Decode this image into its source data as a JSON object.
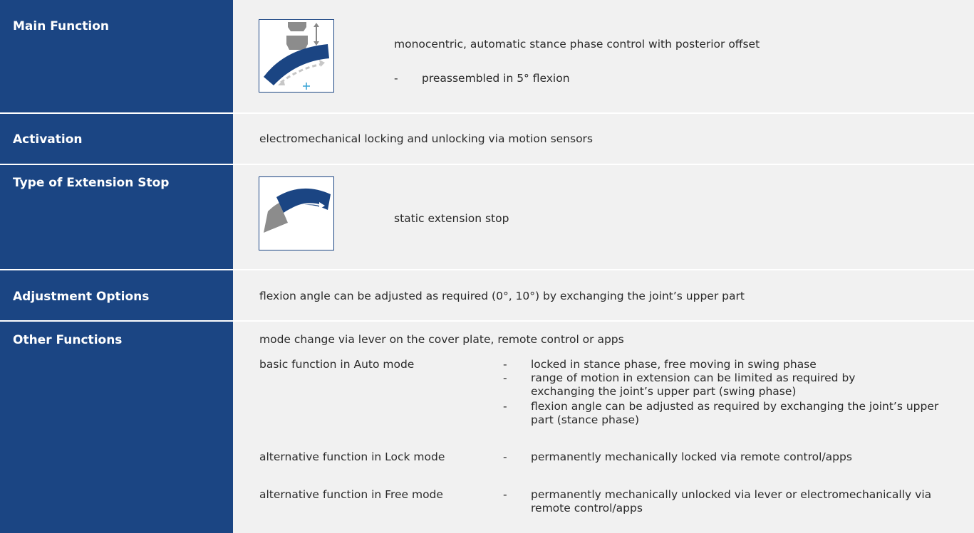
{
  "rows": {
    "main_function": {
      "label": "Main Function",
      "text": "monocentric, automatic stance phase control with posterior offset",
      "sub_dash": "-",
      "sub_text": "preassembled in 5° flexion",
      "icon": "knee-joint-stance-control-icon"
    },
    "activation": {
      "label": "Activation",
      "text": "electromechanical locking and unlocking via motion sensors"
    },
    "extension_stop": {
      "label": "Type of Extension Stop",
      "text": "static extension stop",
      "icon": "extension-stop-icon"
    },
    "adjustment": {
      "label": "Adjustment Options",
      "text": "flexion angle can be adjusted as required (0°, 10°) by exchanging the joint’s upper part"
    },
    "other": {
      "label": "Other Functions",
      "intro": "mode change via lever on the cover plate, remote control or apps",
      "dash": "-",
      "auto": {
        "name": "basic function in Auto mode",
        "items": [
          "locked in stance phase, free moving in swing phase",
          "range of motion in extension can be limited as required by exchanging the joint’s upper part (swing phase)",
          "flexion angle can be adjusted as required by exchanging the joint’s upper part (stance phase)"
        ]
      },
      "lock": {
        "name": "alternative function in Lock mode",
        "item": "permanently mechanically locked via remote control/apps"
      },
      "free": {
        "name": "alternative function in Free mode",
        "item": "permanently mechanically unlocked via lever or electromechanically via remote control/apps"
      }
    }
  },
  "colors": {
    "label_bg": "#1b4583",
    "content_bg": "#f1f1f1",
    "icon_blue": "#1b4583",
    "icon_grey": "#8c8c8c",
    "icon_light_grey": "#c7c7c7",
    "accent_cyan": "#3fa7d6"
  }
}
